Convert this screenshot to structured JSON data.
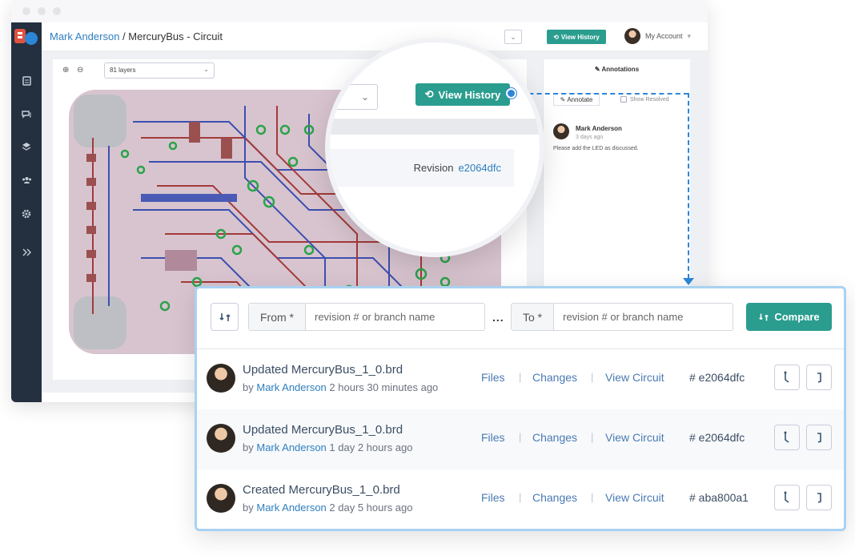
{
  "header": {
    "user": "Mark Anderson",
    "separator": " / ",
    "project": "MercuryBus - Circuit",
    "view_history": "View History",
    "account": "My Account"
  },
  "toolbar": {
    "layers": "81 layers"
  },
  "annotations": {
    "title": "Annotations",
    "annotate_button": "Annotate",
    "show_resolved": "Show Resolved",
    "comment": {
      "author": "Mark Anderson",
      "time": "3 days ago",
      "text": "Please add the LED as discussed."
    }
  },
  "magnifier": {
    "view_history": "View History",
    "revision_label": "Revision",
    "revision_hash": "e2064dfc"
  },
  "compare": {
    "from_label": "From *",
    "from_placeholder": "revision # or branch name",
    "ellipsis": "...",
    "to_label": "To *",
    "to_placeholder": "revision # or branch name",
    "button": "Compare"
  },
  "history": [
    {
      "title": "Updated MercuryBus_1_0.brd",
      "by": "by",
      "author": "Mark Anderson",
      "when": "2 hours 30 minutes ago",
      "files": "Files",
      "changes": "Changes",
      "view": "View Circuit",
      "hash": "# e2064dfc"
    },
    {
      "title": "Updated MercuryBus_1_0.brd",
      "by": "by",
      "author": "Mark Anderson",
      "when": "1 day 2 hours ago",
      "files": "Files",
      "changes": "Changes",
      "view": "View Circuit",
      "hash": "# e2064dfc"
    },
    {
      "title": "Created MercuryBus_1_0.brd",
      "by": "by",
      "author": "Mark Anderson",
      "when": "2 day 5 hours ago",
      "files": "Files",
      "changes": "Changes",
      "view": "View Circuit",
      "hash": "# aba800a1"
    }
  ],
  "link_separator": "|",
  "colors": {
    "accent": "#2a9d8f",
    "link": "#2f7fc0",
    "sidebar": "#243040",
    "connector": "#2c86d8",
    "panel_border": "#a9d2f2"
  },
  "icons": [
    "zoom-in-icon",
    "zoom-out-icon",
    "history-icon",
    "pencil-icon",
    "swap-icon",
    "branch-left-icon",
    "branch-right-icon"
  ]
}
